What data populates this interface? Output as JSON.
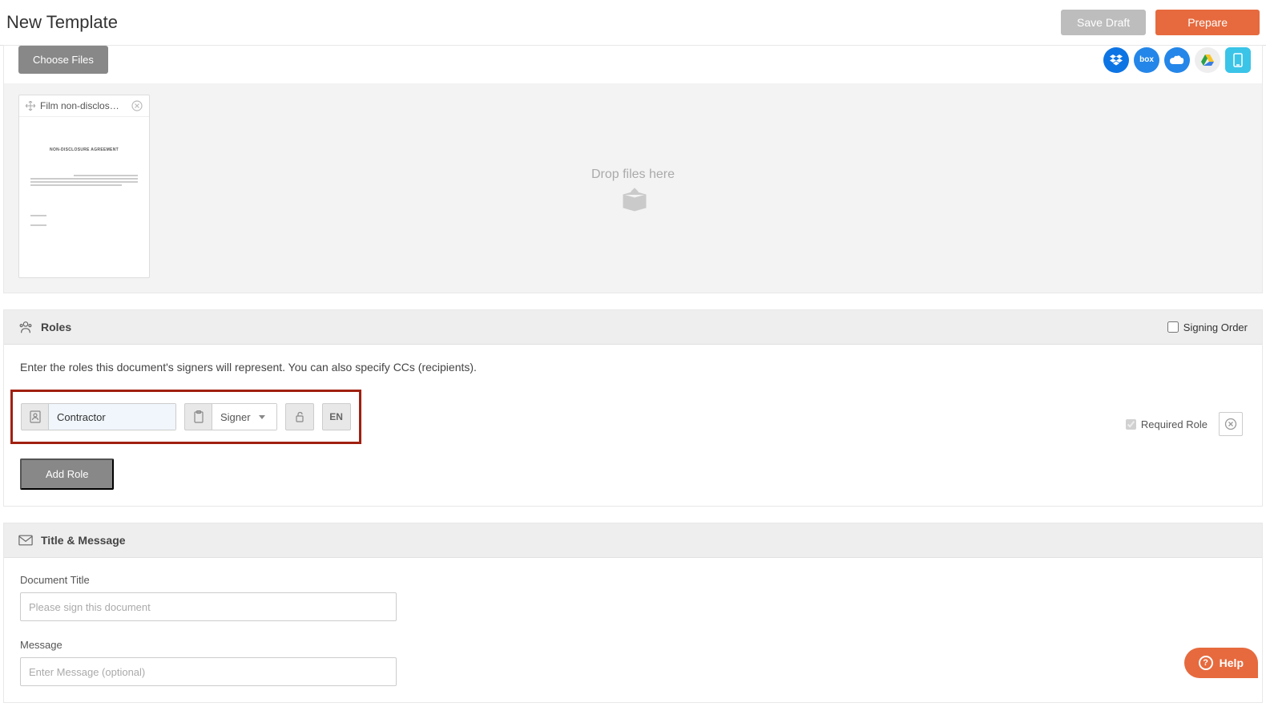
{
  "header": {
    "title": "New Template",
    "save_draft": "Save Draft",
    "prepare": "Prepare"
  },
  "upload": {
    "choose_files": "Choose Files",
    "drop_text": "Drop files here",
    "file_name": "Film non-disclos…",
    "preview_title": "NON-DISCLOSURE AGREEMENT",
    "cloud": [
      "dropbox",
      "box",
      "onedrive",
      "gdrive",
      "other"
    ]
  },
  "roles": {
    "section_title": "Roles",
    "signing_order_label": "Signing Order",
    "signing_order_checked": false,
    "intro": "Enter the roles this document's signers will represent. You can also specify CCs (recipients).",
    "row": {
      "name": "Contractor",
      "type": "Signer",
      "lang": "EN",
      "required_label": "Required Role",
      "required_checked": true
    },
    "add_role": "Add Role"
  },
  "title_msg": {
    "section_title": "Title & Message",
    "doc_title_label": "Document Title",
    "doc_title_placeholder": "Please sign this document",
    "message_label": "Message",
    "message_placeholder": "Enter Message (optional)"
  },
  "help": "Help"
}
